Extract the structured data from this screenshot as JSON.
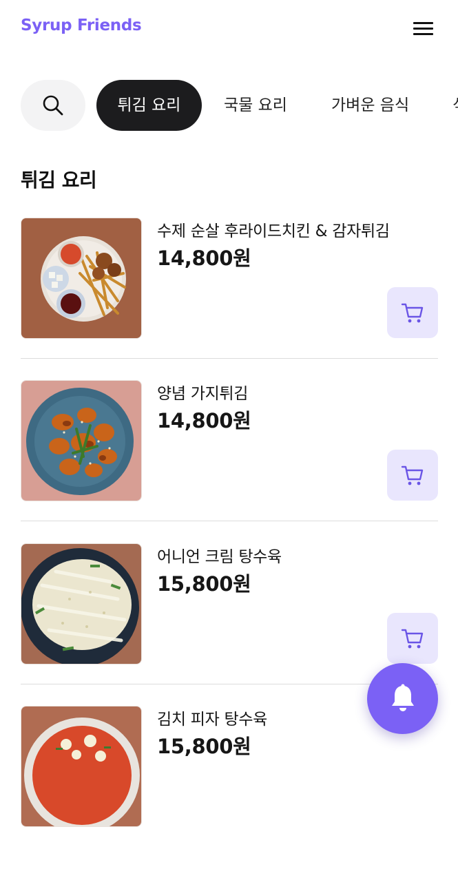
{
  "header": {
    "logo": "Syrup Friends",
    "menu_icon": "hamburger-menu-icon"
  },
  "tabs": {
    "search_icon": "search-icon",
    "items": [
      {
        "label": "튀김 요리",
        "active": true
      },
      {
        "label": "국물 요리",
        "active": false
      },
      {
        "label": "가벼운 음식",
        "active": false
      },
      {
        "label": "식",
        "active": false
      }
    ]
  },
  "section": {
    "title": "튀김 요리"
  },
  "menu_items": [
    {
      "name": "수제 순살 후라이드치킨 & 감자튀김",
      "price": "14,800원",
      "image": "fried-chicken-and-fries-photo"
    },
    {
      "name": "양념 가지튀김",
      "price": "14,800원",
      "image": "seasoned-fried-eggplant-photo"
    },
    {
      "name": "어니언 크림 탕수육",
      "price": "15,800원",
      "image": "onion-cream-sweet-and-sour-pork-photo"
    },
    {
      "name": "김치 피자 탕수육",
      "price": "15,800원",
      "image": "kimchi-pizza-sweet-and-sour-pork-photo"
    }
  ],
  "cart_icon": "cart-icon",
  "fab": {
    "icon": "bell-icon"
  },
  "colors": {
    "brand": "#7b61f5",
    "active_tab": "#1c1c1e",
    "cart_bg": "#e9e6fd",
    "search_bg": "#f3f3f4"
  }
}
